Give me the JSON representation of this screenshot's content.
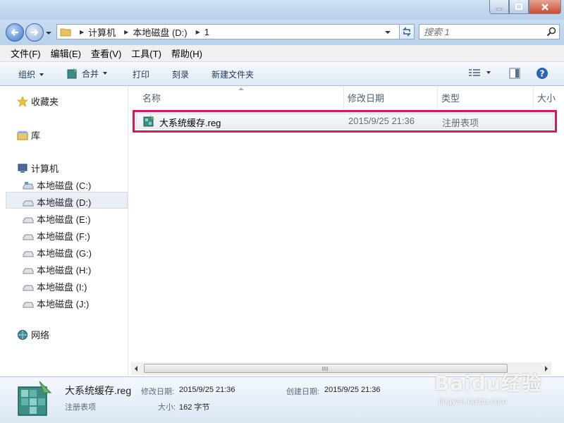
{
  "window": {
    "buttons": {
      "minimize": "minimize",
      "maximize": "maximize",
      "close": "close"
    }
  },
  "address": {
    "crumbs": [
      "计算机",
      "本地磁盘 (D:)",
      "1"
    ],
    "search_placeholder": "搜索 1"
  },
  "menu": [
    "文件(F)",
    "编辑(E)",
    "查看(V)",
    "工具(T)",
    "帮助(H)"
  ],
  "toolbar": {
    "organize": "组织",
    "merge": "合并",
    "print": "打印",
    "burn": "刻录",
    "new_folder": "新建文件夹"
  },
  "nav": {
    "favorites": "收藏夹",
    "libraries": "库",
    "computer": "计算机",
    "drives": [
      "本地磁盘 (C:)",
      "本地磁盘 (D:)",
      "本地磁盘 (E:)",
      "本地磁盘 (F:)",
      "本地磁盘 (G:)",
      "本地磁盘 (H:)",
      "本地磁盘 (I:)",
      "本地磁盘 (J:)"
    ],
    "selected_drive_index": 1,
    "network": "网络"
  },
  "columns": {
    "name": "名称",
    "modified": "修改日期",
    "type": "类型",
    "size": "大小"
  },
  "files": [
    {
      "name": "大系统缓存.reg",
      "modified": "2015/9/25 21:36",
      "type": "注册表项"
    }
  ],
  "details": {
    "filename": "大系统缓存.reg",
    "modified_label": "修改日期:",
    "modified_value": "2015/9/25 21:36",
    "created_label": "创建日期:",
    "created_value": "2015/9/25 21:36",
    "type": "注册表项",
    "size_label": "大小:",
    "size_value": "162 字节"
  },
  "watermark": {
    "main": "Baidu经验",
    "sub": "jingyan.baidu.com"
  },
  "colors": {
    "highlight_border": "#d6195a",
    "window_chrome": "#bcd4ec"
  }
}
